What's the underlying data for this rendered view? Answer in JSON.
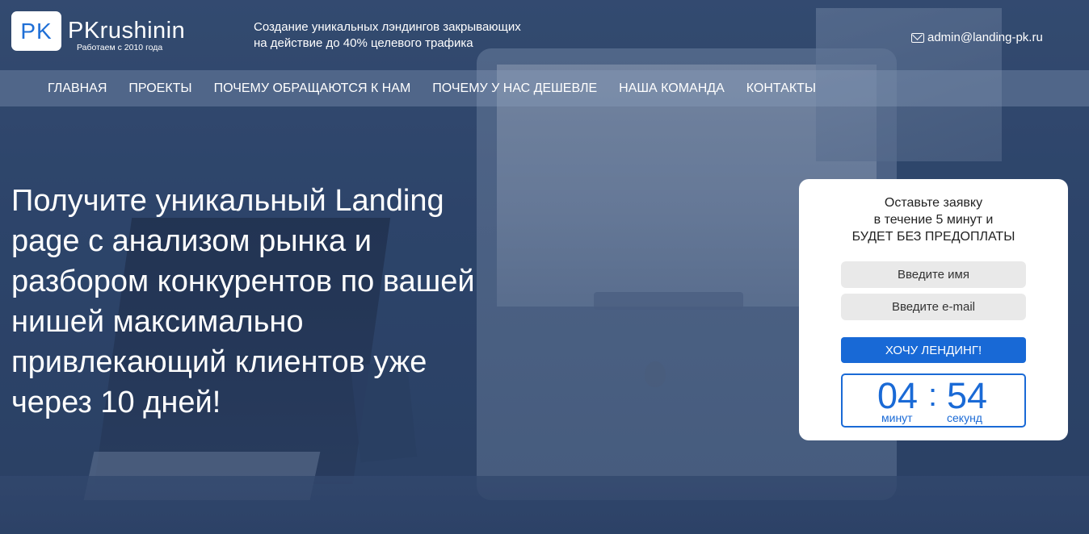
{
  "header": {
    "logo_mark": "PK",
    "logo_name": "PKrushinin",
    "logo_sub": "Работаем с 2010 года",
    "tagline_line1": "Создание уникальных лэндингов закрывающих",
    "tagline_line2": "на действие до 40% целевого трафика",
    "email": "admin@landing-pk.ru"
  },
  "nav": {
    "items": [
      {
        "label": "ГЛАВНАЯ"
      },
      {
        "label": "ПРОЕКТЫ"
      },
      {
        "label": "ПОЧЕМУ ОБРАЩАЮТСЯ К НАМ"
      },
      {
        "label": "ПОЧЕМУ У НАС ДЕШЕВЛЕ"
      },
      {
        "label": "НАША КОМАНДА"
      },
      {
        "label": "КОНТАКТЫ"
      }
    ]
  },
  "hero": {
    "lines": [
      "Получите уникальный Landing",
      "page с анализом рынка и",
      "разбором конкурентов по вашей",
      "нишей максимально",
      "привлекающий клиентов уже",
      "через 10 дней!"
    ]
  },
  "form": {
    "title_line1": "Оставьте заявку",
    "title_line2": "в течение 5 минут и",
    "title_line3": "БУДЕТ БЕЗ ПРЕДОПЛАТЫ",
    "name_placeholder": "Введите имя",
    "email_placeholder": "Введите e-mail",
    "submit_label": "ХОЧУ ЛЕНДИНГ!",
    "timer": {
      "minutes": "04",
      "separator": ":",
      "seconds": "54",
      "minutes_label": "минут",
      "seconds_label": "секунд"
    }
  },
  "colors": {
    "accent": "#1869d6",
    "nav_bg": "#8ca0be",
    "background": "#2f4567"
  }
}
